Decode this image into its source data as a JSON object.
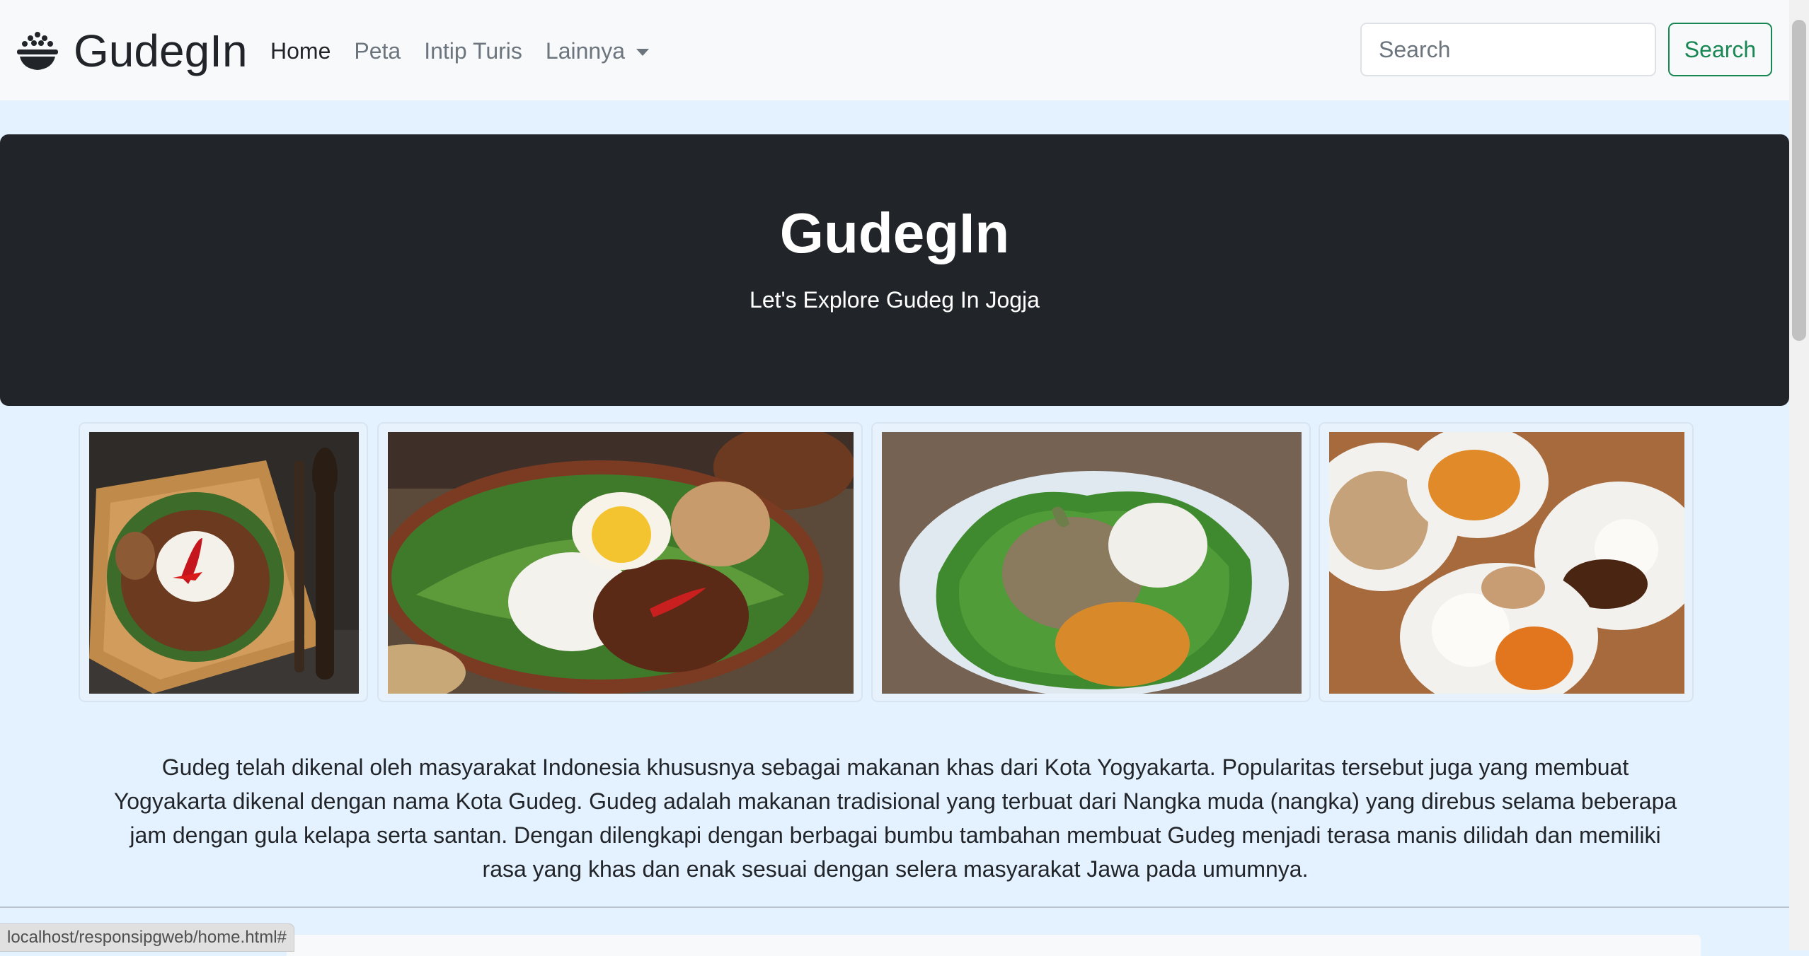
{
  "navbar": {
    "brand": "GudegIn",
    "brand_icon": "rice-bowl-icon",
    "links": [
      {
        "label": "Home",
        "active": true
      },
      {
        "label": "Peta",
        "active": false
      },
      {
        "label": "Intip Turis",
        "active": false
      },
      {
        "label": "Lainnya",
        "active": false,
        "dropdown": true
      }
    ],
    "search_placeholder": "Search",
    "search_button": "Search"
  },
  "hero": {
    "title": "GudegIn",
    "subtitle": "Let's Explore Gudeg In Jogja"
  },
  "gallery": [
    {
      "name": "gudeg-photo-1"
    },
    {
      "name": "gudeg-photo-2"
    },
    {
      "name": "gudeg-photo-3"
    },
    {
      "name": "gudeg-photo-4"
    }
  ],
  "description": "Gudeg telah dikenal oleh masyarakat Indonesia khususnya sebagai makanan khas dari Kota Yogyakarta. Popularitas tersebut juga yang membuat Yogyakarta dikenal dengan nama Kota Gudeg. Gudeg adalah makanan tradisional yang terbuat dari Nangka muda (nangka) yang direbus selama beberapa jam dengan gula kelapa serta santan. Dengan dilengkapi dengan berbagai bumbu tambahan membuat Gudeg menjadi terasa manis dilidah dan memiliki rasa yang khas dan enak sesuai dengan selera masyarakat Jawa pada umumnya.",
  "status_bar": {
    "url": "localhost/responsipgweb/home.html#"
  },
  "colors": {
    "page_background": "#e4f1fe",
    "navbar_background": "#f8f9fa",
    "hero_background": "#212529",
    "success_green": "#198754"
  }
}
